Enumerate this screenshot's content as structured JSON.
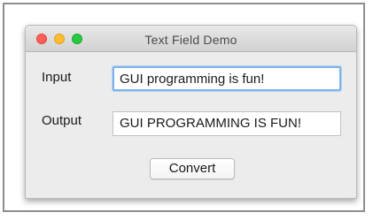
{
  "window": {
    "title": "Text Field Demo"
  },
  "form": {
    "input_label": "Input",
    "input_value": "GUI programming is fun!",
    "output_label": "Output",
    "output_value": "GUI PROGRAMMING IS FUN!",
    "convert_label": "Convert"
  },
  "colors": {
    "close": "#ff5f57",
    "minimize": "#febc2e",
    "maximize": "#28c840",
    "focus_ring": "#7fb1ea"
  }
}
